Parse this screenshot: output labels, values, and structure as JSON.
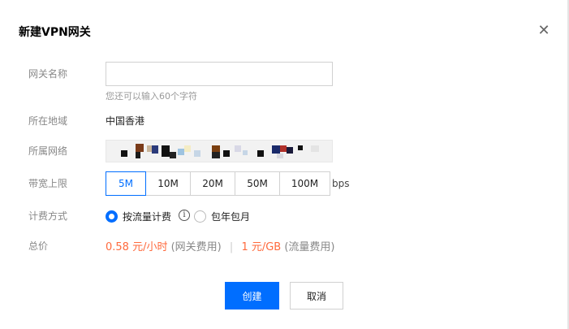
{
  "dialog": {
    "title": "新建VPN网关",
    "close_icon": "close-icon"
  },
  "form": {
    "name": {
      "label": "网关名称",
      "value": "",
      "placeholder": "",
      "hint": "您还可以输入60个字符"
    },
    "region": {
      "label": "所在地域",
      "value": "中国香港"
    },
    "network": {
      "label": "所属网络",
      "value_redacted": true
    },
    "bandwidth": {
      "label": "带宽上限",
      "options": [
        "5M",
        "10M",
        "20M",
        "50M",
        "100M"
      ],
      "selected": "5M",
      "unit": "bps"
    },
    "billing": {
      "label": "计费方式",
      "options": [
        {
          "label": "按流量计费",
          "checked": true
        },
        {
          "label": "包年包月",
          "checked": false
        }
      ],
      "info_icon": "info-icon"
    },
    "price": {
      "label": "总价",
      "gateway_amount": "0.58 元/小时",
      "gateway_note": "(网关费用)",
      "separator": "|",
      "traffic_amount": "1 元/GB",
      "traffic_note": "(流量费用)"
    }
  },
  "actions": {
    "create_label": "创建",
    "cancel_label": "取消"
  },
  "colors": {
    "primary": "#006eff",
    "price": "#ff6a3d",
    "label": "#888888"
  }
}
